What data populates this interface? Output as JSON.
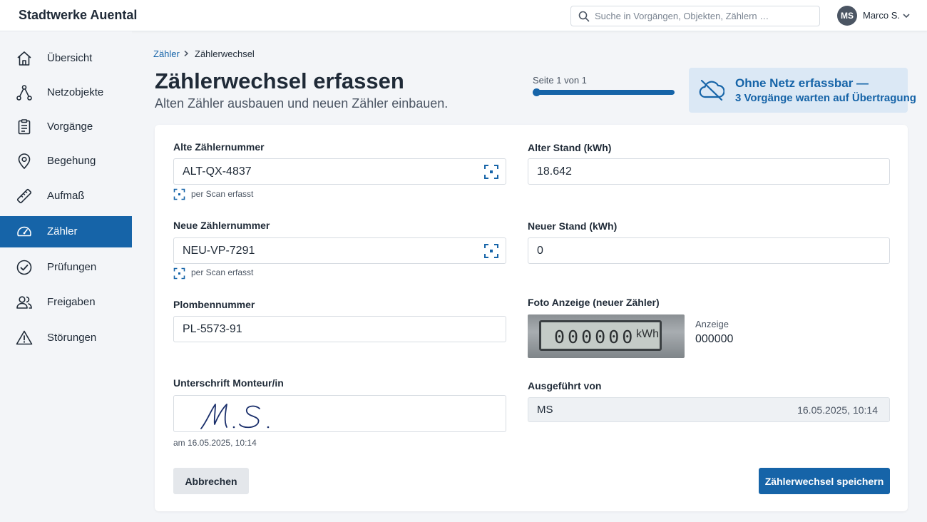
{
  "header": {
    "brand": "Stadtwerke Auental",
    "search_placeholder": "Suche in Vorgängen, Objekten, Zählern …",
    "user_initials": "MS",
    "user_name": "Marco S."
  },
  "sidebar": {
    "items": [
      {
        "label": "Übersicht",
        "icon": "home-icon"
      },
      {
        "label": "Netzobjekte",
        "icon": "network-icon"
      },
      {
        "label": "Vorgänge",
        "icon": "clipboard-icon"
      },
      {
        "label": "Begehung",
        "icon": "map-pin-icon"
      },
      {
        "label": "Aufmaß",
        "icon": "ruler-icon"
      },
      {
        "label": "Zähler",
        "icon": "gauge-icon",
        "active": true
      },
      {
        "label": "Prüfungen",
        "icon": "check-circle-icon"
      },
      {
        "label": "Freigaben",
        "icon": "users-icon"
      },
      {
        "label": "Störungen",
        "icon": "warning-icon"
      }
    ]
  },
  "breadcrumb": {
    "parent": "Zähler",
    "current": "Zählerwechsel"
  },
  "page": {
    "title": "Zählerwechsel erfassen",
    "subtitle": "Alten Zähler ausbauen und neuen Zähler einbauen."
  },
  "progress": {
    "label": "Seite 1 von 1",
    "fraction": 1.0
  },
  "offline_banner": {
    "line1": "Ohne Netz erfassbar —",
    "line2": "3 Vorgänge warten auf Übertragung"
  },
  "form": {
    "old_meter_label": "Alte Zählernummer",
    "old_meter_value": "ALT-QX-4837",
    "old_meter_hint": "per Scan erfasst",
    "new_meter_label": "Neue Zählernummer",
    "new_meter_value": "NEU-VP-7291",
    "new_meter_hint": "per Scan erfasst",
    "seal_label": "Plombennummer",
    "seal_value": "PL-5573-91",
    "signature_label": "Unterschrift Monteur/in",
    "signature_date": "am 16.05.2025, 10:14",
    "old_reading_label": "Alter Stand (kWh)",
    "old_reading_value": "18.642",
    "new_reading_label": "Neuer Stand (kWh)",
    "new_reading_value": "0",
    "photo_label": "Foto Anzeige (neuer Zähler)",
    "photo_digits": "000000",
    "photo_unit": "kWh",
    "display_label": "Anzeige",
    "display_value": "000000",
    "executed_label": "Ausgeführt von",
    "executed_value": "MS",
    "executed_time": "16.05.2025, 10:14"
  },
  "actions": {
    "cancel": "Abbrechen",
    "save": "Zählerwechsel speichern"
  },
  "colors": {
    "primary": "#1664a8",
    "banner_bg": "#dbe8f5",
    "sidebar_bg": "#f3f5f8"
  }
}
